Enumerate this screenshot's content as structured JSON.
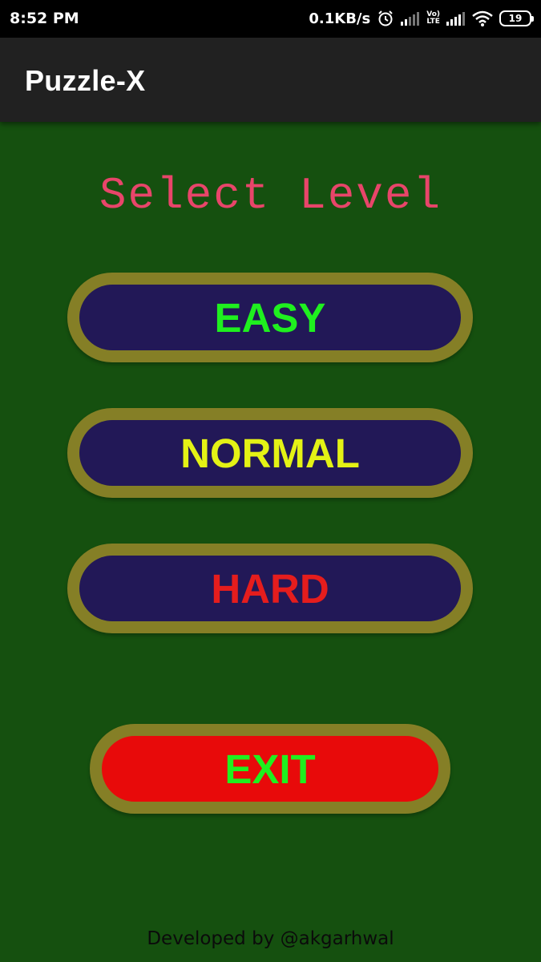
{
  "status_bar": {
    "time": "8:52 PM",
    "net_speed": "0.1KB/s",
    "volte_top": "Vo)",
    "volte_bottom": "LTE",
    "battery": "19",
    "icons": [
      "alarm-icon",
      "signal-weak-icon",
      "volte-icon",
      "signal-icon",
      "wifi-icon",
      "battery-icon"
    ]
  },
  "app_bar": {
    "title": "Puzzle-X"
  },
  "main": {
    "heading": "Select Level",
    "levels": [
      {
        "label": "EASY",
        "color": "#1ff01f"
      },
      {
        "label": "NORMAL",
        "color": "#e4f215"
      },
      {
        "label": "HARD",
        "color": "#e51d1d"
      }
    ],
    "exit_label": "EXIT"
  },
  "footer": {
    "credit": "Developed by @akgarhwal"
  },
  "colors": {
    "background": "#15500f",
    "app_bar": "#212121",
    "status_bar": "#000000",
    "heading": "#e8456a",
    "button_fill": "#221857",
    "button_border": "#857f26",
    "exit_fill": "#e80a0a"
  }
}
